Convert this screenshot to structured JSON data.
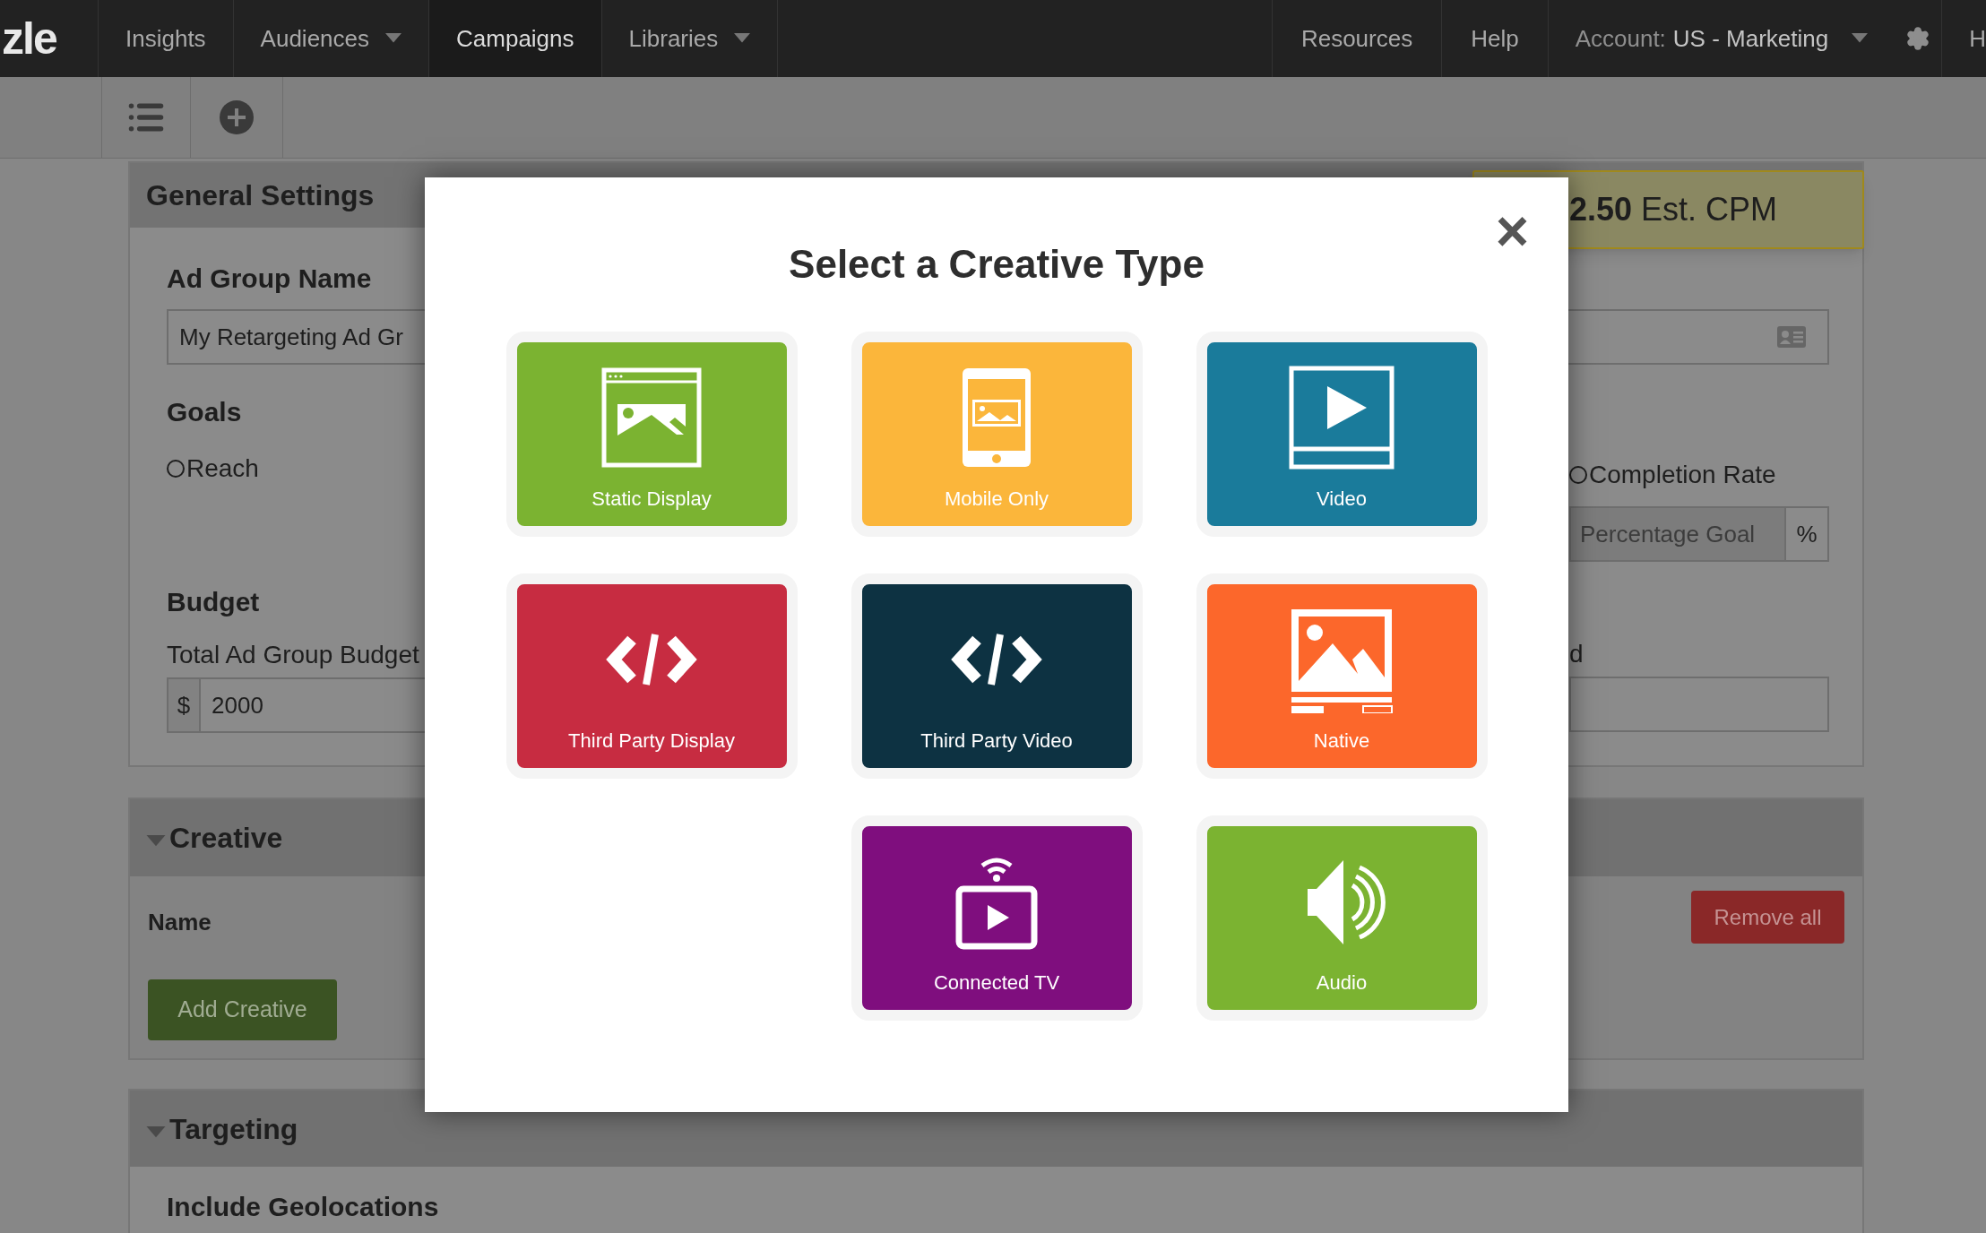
{
  "nav": {
    "logo": "zle",
    "items": [
      {
        "label": "Insights",
        "dropdown": false,
        "selected": false
      },
      {
        "label": "Audiences",
        "dropdown": true,
        "selected": false
      },
      {
        "label": "Campaigns",
        "dropdown": false,
        "selected": true
      },
      {
        "label": "Libraries",
        "dropdown": true,
        "selected": false
      }
    ],
    "right_items": [
      {
        "label": "Resources"
      },
      {
        "label": "Help"
      }
    ],
    "account": {
      "label": "Account:",
      "value": "US - Marketing"
    },
    "cut_item": "H"
  },
  "general_settings": {
    "title": "General Settings",
    "est_cpm": "**2.50** Est. CPM",
    "ad_group_name": {
      "label": "Ad Group Name",
      "value": "My Retargeting Ad Gr"
    },
    "goals": {
      "label": "Goals",
      "options": [
        {
          "label": "Reach",
          "selected": false
        },
        {
          "label": "Completion Rate",
          "selected": false
        }
      ],
      "percentage_goal": {
        "placeholder": "Percentage Goal",
        "suffix": "%"
      }
    },
    "budget": {
      "label": "Budget",
      "total": {
        "label": "Total Ad Group Budget",
        "prefix": "$",
        "value": "2000"
      },
      "right_label": "d"
    }
  },
  "creative": {
    "title": "Creative",
    "expanded": true,
    "column": "Name",
    "add_button": "Add Creative",
    "remove_button": "Remove all"
  },
  "targeting": {
    "title": "Targeting",
    "expanded": true,
    "subheading": "Include Geolocations"
  },
  "modal": {
    "title": "Select a Creative Type",
    "close": "×",
    "tiles": [
      {
        "label": "Static Display",
        "kind": "display",
        "color": "#7bb331"
      },
      {
        "label": "Mobile Only",
        "kind": "mobile",
        "color": "#fbb63b"
      },
      {
        "label": "Video",
        "kind": "video",
        "color": "#1a7b9b"
      },
      {
        "label": "Third Party Display",
        "kind": "code",
        "color": "#c72c41"
      },
      {
        "label": "Third Party Video",
        "kind": "code",
        "color": "#0d3242"
      },
      {
        "label": "Native",
        "kind": "native",
        "color": "#fc672b"
      },
      {
        "label": "Connected TV",
        "kind": "tv",
        "color": "#7f0e7e"
      },
      {
        "label": "Audio",
        "kind": "audio",
        "color": "#7bb331"
      }
    ]
  }
}
